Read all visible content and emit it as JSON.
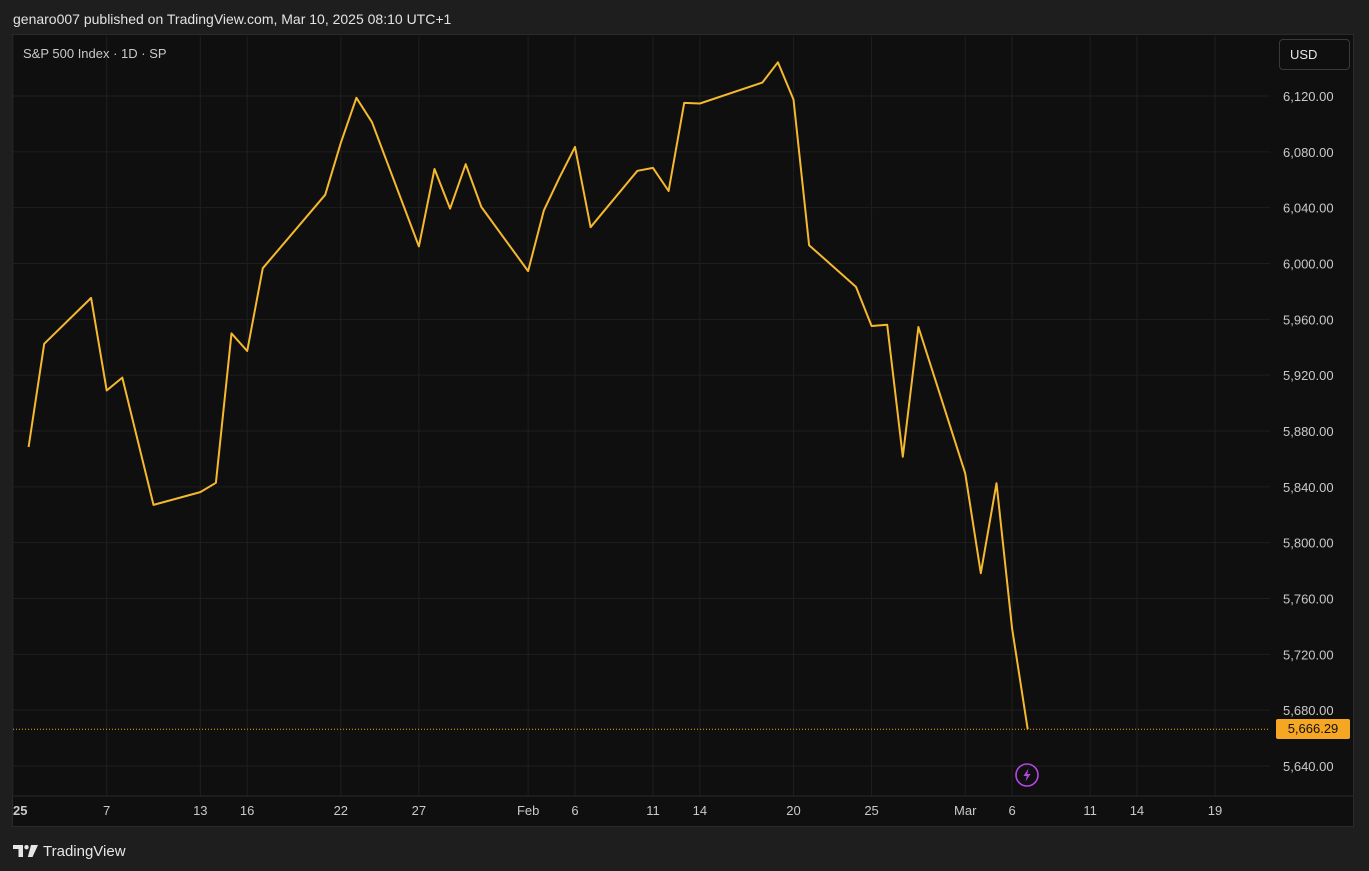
{
  "header": {
    "published_text": "genaro007 published on TradingView.com, Mar 10, 2025 08:10 UTC+1"
  },
  "chart": {
    "symbol_title": "S&P 500 Index · 1D · SP",
    "currency": "USD",
    "last_price_label": "5,666.29",
    "footer_brand": "TradingView"
  },
  "colors": {
    "background": "#0f0f0f",
    "line": "#f5b82e",
    "grid": "#1f1f1f",
    "price_tag": "#f5a623",
    "flash_icon": "#b845e6"
  },
  "chart_data": {
    "type": "line",
    "title": "S&P 500 Index · 1D · SP",
    "xlabel": "",
    "ylabel": "",
    "ylim": [
      5620,
      6160
    ],
    "grid": true,
    "y_ticks": [
      {
        "value": 6120,
        "label": "6,120.00"
      },
      {
        "value": 6080,
        "label": "6,080.00"
      },
      {
        "value": 6040,
        "label": "6,040.00"
      },
      {
        "value": 6000,
        "label": "6,000.00"
      },
      {
        "value": 5960,
        "label": "5,960.00"
      },
      {
        "value": 5920,
        "label": "5,920.00"
      },
      {
        "value": 5880,
        "label": "5,880.00"
      },
      {
        "value": 5840,
        "label": "5,840.00"
      },
      {
        "value": 5800,
        "label": "5,800.00"
      },
      {
        "value": 5760,
        "label": "5,760.00"
      },
      {
        "value": 5720,
        "label": "5,720.00"
      },
      {
        "value": 5680,
        "label": "5,680.00"
      },
      {
        "value": 5640,
        "label": "5,640.00"
      }
    ],
    "x_ticks": [
      {
        "date": "2025-01-01",
        "label": "25",
        "bold": true
      },
      {
        "date": "2025-01-07",
        "label": "7"
      },
      {
        "date": "2025-01-13",
        "label": "13"
      },
      {
        "date": "2025-01-16",
        "label": "16"
      },
      {
        "date": "2025-01-22",
        "label": "22"
      },
      {
        "date": "2025-01-27",
        "label": "27"
      },
      {
        "date": "2025-02-03",
        "label": "Feb"
      },
      {
        "date": "2025-02-06",
        "label": "6"
      },
      {
        "date": "2025-02-11",
        "label": "11"
      },
      {
        "date": "2025-02-14",
        "label": "14"
      },
      {
        "date": "2025-02-20",
        "label": "20"
      },
      {
        "date": "2025-02-25",
        "label": "25"
      },
      {
        "date": "2025-03-03",
        "label": "Mar"
      },
      {
        "date": "2025-03-06",
        "label": "6"
      },
      {
        "date": "2025-03-11",
        "label": "11"
      },
      {
        "date": "2025-03-14",
        "label": "14"
      },
      {
        "date": "2025-03-19",
        "label": "19"
      }
    ],
    "series": [
      {
        "x": [
          "2025-01-02",
          "2025-01-03",
          "2025-01-06",
          "2025-01-07",
          "2025-01-08",
          "2025-01-10",
          "2025-01-13",
          "2025-01-14",
          "2025-01-15",
          "2025-01-16",
          "2025-01-17",
          "2025-01-21",
          "2025-01-22",
          "2025-01-23",
          "2025-01-24",
          "2025-01-27",
          "2025-01-28",
          "2025-01-29",
          "2025-01-30",
          "2025-01-31",
          "2025-02-03",
          "2025-02-04",
          "2025-02-05",
          "2025-02-06",
          "2025-02-07",
          "2025-02-10",
          "2025-02-11",
          "2025-02-12",
          "2025-02-13",
          "2025-02-14",
          "2025-02-18",
          "2025-02-19",
          "2025-02-20",
          "2025-02-21",
          "2025-02-24",
          "2025-02-25",
          "2025-02-26",
          "2025-02-27",
          "2025-02-28",
          "2025-03-03",
          "2025-03-04",
          "2025-03-05",
          "2025-03-06",
          "2025-03-07"
        ],
        "values": [
          5868.55,
          5942.47,
          5975.38,
          5909.03,
          5918.25,
          5827.04,
          5836.22,
          5842.91,
          5949.91,
          5937.34,
          5996.66,
          6049.24,
          6086.37,
          6118.71,
          6101.24,
          6012.28,
          6067.7,
          6039.31,
          6071.17,
          6040.53,
          5994.57,
          6037.88,
          6061.48,
          6083.57,
          6025.99,
          6066.44,
          6068.5,
          6051.97,
          6115.07,
          6114.63,
          6129.58,
          6144.15,
          6117.52,
          6013.13,
          5983.25,
          5955.25,
          5956.06,
          5861.57,
          5954.5,
          5849.72,
          5778.15,
          5842.63,
          5738.52,
          5666.29
        ]
      }
    ],
    "last_value": 5666.29
  }
}
